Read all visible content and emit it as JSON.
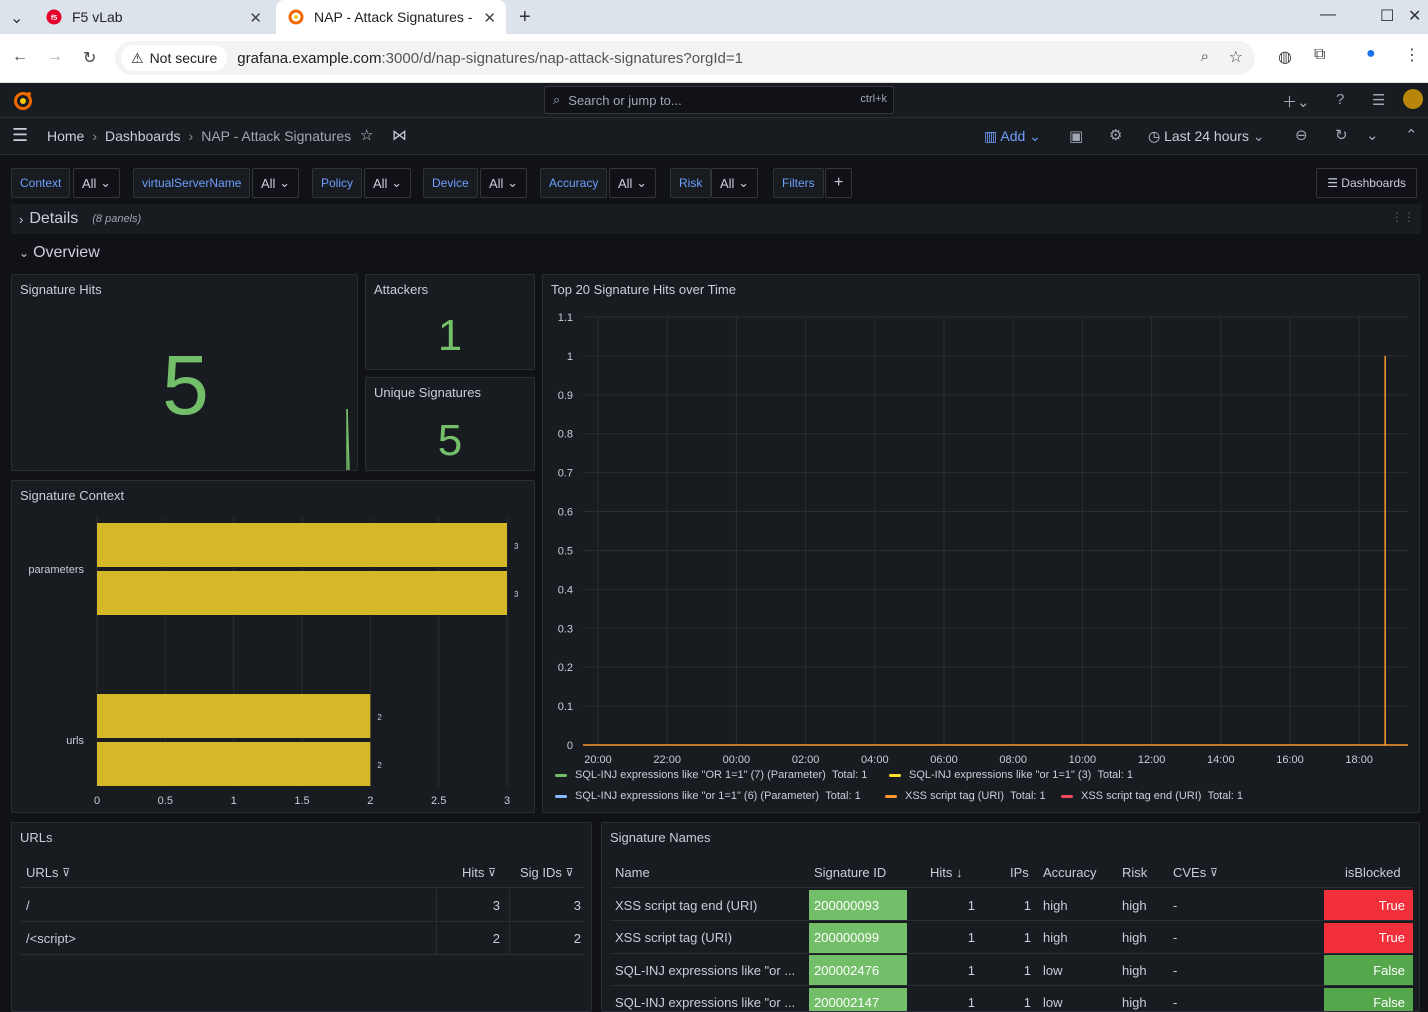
{
  "browser": {
    "tabs": [
      {
        "title": "F5 vLab",
        "active": false
      },
      {
        "title": "NAP - Attack Signatures -",
        "active": true
      }
    ],
    "address": {
      "security": "Not secure",
      "host": "grafana.example.com",
      "path": ":3000/d/nap-signatures/nap-attack-signatures?orgId=1"
    }
  },
  "topbar": {
    "search_placeholder": "Search or jump to...",
    "shortcut": "ctrl+k"
  },
  "nav": {
    "breadcrumbs": [
      "Home",
      "Dashboards",
      "NAP - Attack Signatures"
    ],
    "add_label": "Add",
    "time_range": "Last 24 hours"
  },
  "variables": [
    {
      "label": "Context",
      "value": "All"
    },
    {
      "label": "virtualServerName",
      "value": "All"
    },
    {
      "label": "Policy",
      "value": "All"
    },
    {
      "label": "Device",
      "value": "All"
    },
    {
      "label": "Accuracy",
      "value": "All"
    },
    {
      "label": "Risk",
      "value": "All"
    }
  ],
  "filters_label": "Filters",
  "dashboards_button": "Dashboards",
  "rows": {
    "details": {
      "title": "Details",
      "count": "(8 panels)"
    },
    "overview": {
      "title": "Overview"
    }
  },
  "panels": {
    "signature_hits": {
      "title": "Signature Hits",
      "value": "5"
    },
    "attackers": {
      "title": "Attackers",
      "value": "1"
    },
    "unique_signatures": {
      "title": "Unique Signatures",
      "value": "5"
    },
    "signature_context": {
      "title": "Signature Context"
    },
    "timeseries": {
      "title": "Top 20 Signature Hits over Time"
    },
    "urls": {
      "title": "URLs"
    },
    "signature_names": {
      "title": "Signature Names"
    }
  },
  "chart_data": [
    {
      "type": "bar",
      "title": "Signature Context",
      "orientation": "horizontal",
      "categories": [
        "parameters",
        "urls"
      ],
      "series": [
        {
          "values": [
            3,
            2
          ]
        },
        {
          "values": [
            3,
            2
          ]
        }
      ],
      "xlim": [
        0,
        3
      ],
      "xticks": [
        "0",
        "0.5",
        "1",
        "1.5",
        "2",
        "2.5",
        "3"
      ],
      "color": "#d4b828"
    },
    {
      "type": "line",
      "title": "Top 20 Signature Hits over Time",
      "xticks": [
        "20:00",
        "22:00",
        "00:00",
        "02:00",
        "04:00",
        "06:00",
        "08:00",
        "10:00",
        "12:00",
        "14:00",
        "16:00",
        "18:00"
      ],
      "yticks": [
        "0",
        "0.1",
        "0.2",
        "0.3",
        "0.4",
        "0.5",
        "0.6",
        "0.7",
        "0.8",
        "0.9",
        "1",
        "1.1"
      ],
      "ylim": [
        0,
        1.1
      ],
      "spike_at": "18:45",
      "series": [
        {
          "name": "SQL-INJ expressions like \"OR 1=1\" (7) (Parameter)",
          "total": "Total: 1",
          "color": "#73bf69"
        },
        {
          "name": "SQL-INJ expressions like \"or 1=1\" (3)",
          "total": "Total: 1",
          "color": "#fade2a"
        },
        {
          "name": "SQL-INJ expressions like \"or 1=1\" (6) (Parameter)",
          "total": "Total: 1",
          "color": "#8ab8ff"
        },
        {
          "name": "XSS script tag (URI)",
          "total": "Total: 1",
          "color": "#ff9830"
        },
        {
          "name": "XSS script tag end (URI)",
          "total": "Total: 1",
          "color": "#f2495c"
        }
      ]
    }
  ],
  "urls_table": {
    "columns": [
      "URLs",
      "Hits",
      "Sig IDs"
    ],
    "rows": [
      {
        "url": "/",
        "hits": "3",
        "sigids": "3"
      },
      {
        "url": "/<script>",
        "hits": "2",
        "sigids": "2"
      }
    ]
  },
  "sig_table": {
    "columns": [
      "Name",
      "Signature ID",
      "Hits",
      "IPs",
      "Accuracy",
      "Risk",
      "CVEs",
      "isBlocked"
    ],
    "rows": [
      {
        "name": "XSS script tag end (URI)",
        "id": "200000093",
        "hits": "1",
        "ips": "1",
        "accuracy": "high",
        "risk": "high",
        "cves": "-",
        "blocked": "True"
      },
      {
        "name": "XSS script tag (URI)",
        "id": "200000099",
        "hits": "1",
        "ips": "1",
        "accuracy": "high",
        "risk": "high",
        "cves": "-",
        "blocked": "True"
      },
      {
        "name": "SQL-INJ expressions like \"or ...",
        "id": "200002476",
        "hits": "1",
        "ips": "1",
        "accuracy": "low",
        "risk": "high",
        "cves": "-",
        "blocked": "False"
      },
      {
        "name": "SQL-INJ expressions like \"or ...",
        "id": "200002147",
        "hits": "1",
        "ips": "1",
        "accuracy": "low",
        "risk": "high",
        "cves": "-",
        "blocked": "False"
      }
    ],
    "colors": {
      "id_bg": "#73bf69",
      "true_bg": "#f2303c",
      "false_bg": "#56a64b"
    }
  }
}
